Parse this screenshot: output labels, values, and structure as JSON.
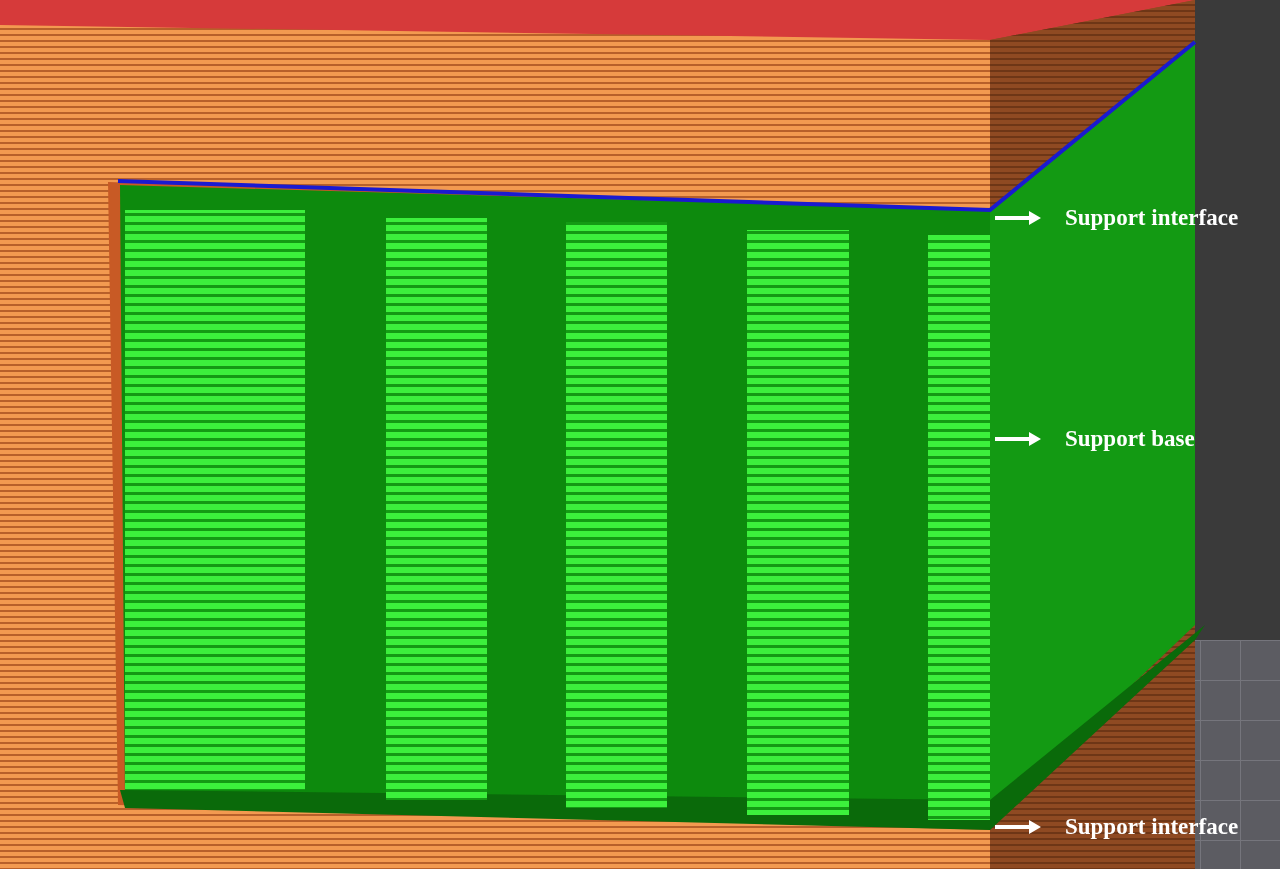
{
  "annotations": [
    {
      "label": "Support interface"
    },
    {
      "label": "Support base"
    },
    {
      "label": "Support interface"
    }
  ]
}
